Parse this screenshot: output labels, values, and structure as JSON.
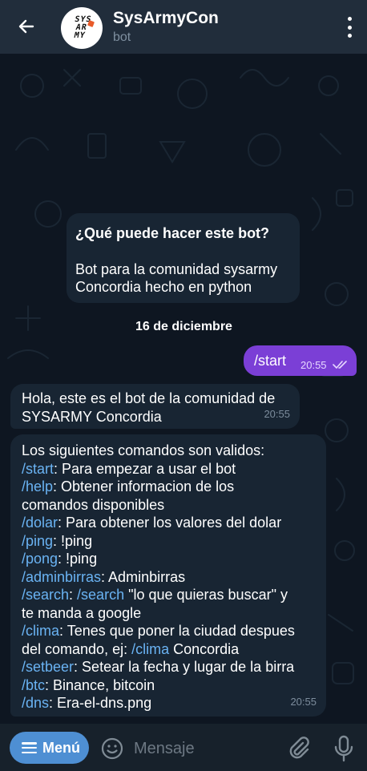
{
  "header": {
    "title": "SysArmyCon",
    "subtitle": "bot",
    "avatar_lines": [
      "SYS",
      "AR",
      "MY"
    ]
  },
  "chat": {
    "intro": {
      "title": "¿Qué puede hacer este bot?",
      "description_lines": [
        "Bot para la comunidad sysarmy",
        "Concordia hecho en python"
      ]
    },
    "date_separator": "16 de diciembre",
    "outgoing": {
      "text": "/start",
      "time": "20:55"
    },
    "incoming_1": {
      "lines": [
        "Hola, este es el bot de la comunidad de",
        "SYSARMY Concordia"
      ],
      "time": "20:55"
    },
    "incoming_2": {
      "intro": "Los siguientes comandos son validos:",
      "lines": [
        {
          "cmd": "/start",
          "text": ": Para empezar a usar el bot"
        },
        {
          "cmd": "/help",
          "text": ": Obtener informacion de los"
        },
        {
          "cmd": "",
          "text": "comandos disponibles"
        },
        {
          "cmd": "/dolar",
          "text": ": Para obtener los valores del dolar"
        },
        {
          "cmd": "/ping",
          "text": ": !ping"
        },
        {
          "cmd": "/pong",
          "text": ": !ping"
        },
        {
          "cmd": "/adminbirras",
          "text": ": Adminbirras"
        },
        {
          "cmd": "/search",
          "text": ": ",
          "cmd2": "/search",
          "text2": " \"lo que quieras buscar\" y"
        },
        {
          "cmd": "",
          "text": "te manda a google"
        },
        {
          "cmd": "/clima",
          "text": ": Tenes que poner la ciudad despues"
        },
        {
          "cmd": "",
          "text": "del comando, ej: ",
          "cmd2": "/clima",
          "text2": " Concordia"
        },
        {
          "cmd": "/setbeer",
          "text": ": Setear la fecha y lugar de la birra"
        },
        {
          "cmd": "/btc",
          "text": ": Binance, bitcoin"
        },
        {
          "cmd": "/dns",
          "text": ": Era-el-dns.png"
        }
      ],
      "time": "20:55"
    }
  },
  "input_bar": {
    "menu_label": "Menú",
    "placeholder": "Mensaje"
  },
  "icons": {
    "back": "arrow-left-icon",
    "more": "more-vertical-icon",
    "emoji": "emoji-icon",
    "attach": "paperclip-icon",
    "mic": "microphone-icon",
    "read": "double-check-icon"
  },
  "colors": {
    "header_bg": "#212d3b",
    "chat_bg": "#0e1621",
    "incoming_bubble": "#182533",
    "outgoing_bubble": "#7b3fd6",
    "command_link": "#6ab3f3",
    "menu_button": "#4e8fd3"
  }
}
